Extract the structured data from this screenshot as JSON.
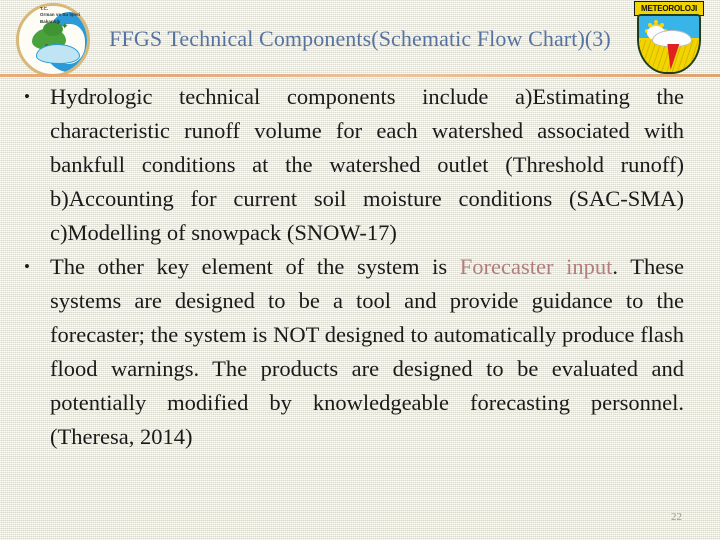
{
  "header": {
    "title": "FFGS Technical Components(Schematic Flow Chart)(3)",
    "left_logo": {
      "name": "ministry-logo",
      "text_line1": "T.C.",
      "text_line2": "Orman ve Su İşleri",
      "text_line3": "Bakanlığı"
    },
    "right_logo": {
      "name": "meteoroloji-logo",
      "banner_text": "METEOROLOJI"
    },
    "title_color": "#5672a0",
    "rule_color": "#e8a36a"
  },
  "body": {
    "bullets": [
      {
        "text": "Hydrologic technical components include a)Estimating the characteristic runoff volume for each watershed associated with bankfull conditions at the watershed outlet (Threshold runoff) b)Accounting for current soil moisture conditions (SAC-SMA) c)Modelling of snowpack (SNOW-17)"
      },
      {
        "prefix": "The other key element of the system is ",
        "highlight": "Forecaster input",
        "suffix": ". These systems are designed to be a tool and provide guidance to the forecaster; the system is NOT designed to automatically produce flash flood warnings. The products are designed to be evaluated and potentially modified by knowledgeable forecasting personnel. (Theresa, 2014)",
        "highlight_color": "#b27d7d"
      }
    ],
    "page_number": "22"
  },
  "colors": {
    "background": "#f1f1e4",
    "text": "#1a1a1a"
  }
}
